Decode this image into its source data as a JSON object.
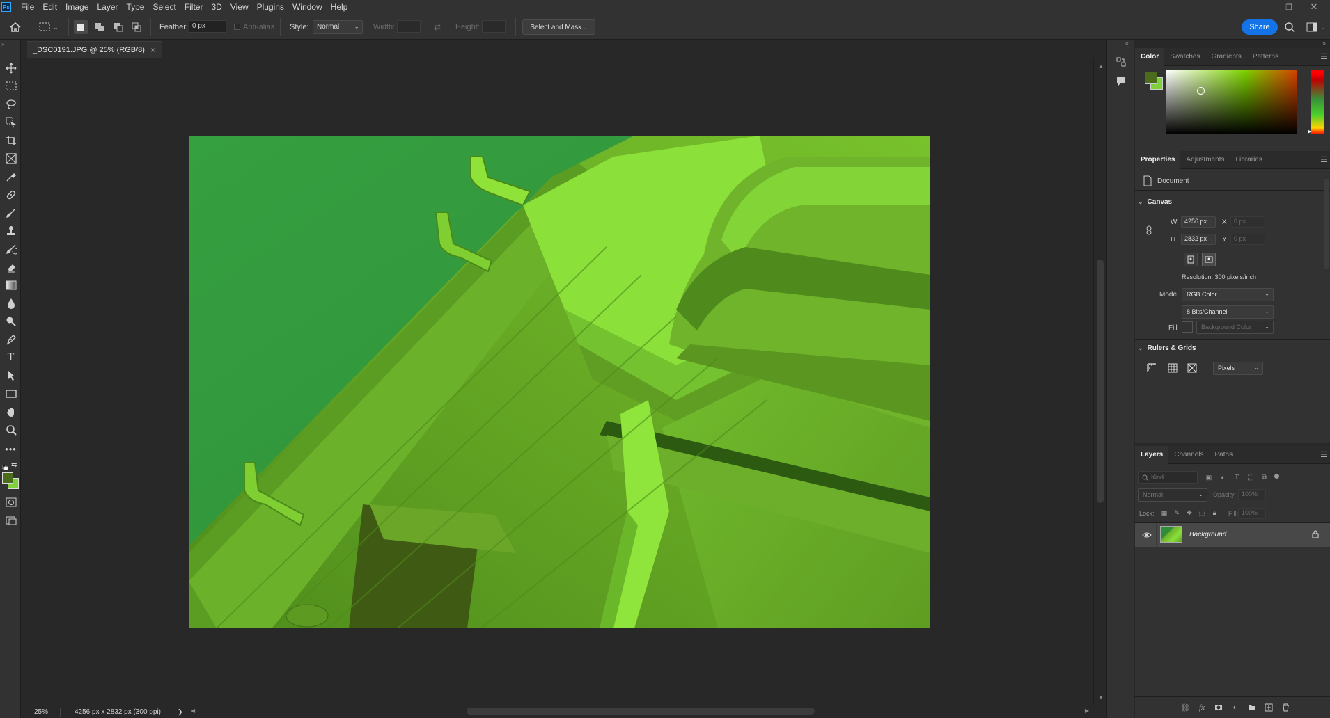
{
  "app": {
    "logo_text": "Ps"
  },
  "menu": [
    "File",
    "Edit",
    "Image",
    "Layer",
    "Type",
    "Select",
    "Filter",
    "3D",
    "View",
    "Plugins",
    "Window",
    "Help"
  ],
  "window_controls": {
    "minimize": "–",
    "restore": "❐",
    "close": "✕"
  },
  "options": {
    "feather_label": "Feather:",
    "feather_value": "0 px",
    "antialias_label": "Anti-alias",
    "style_label": "Style:",
    "style_value": "Normal",
    "width_label": "Width:",
    "height_label": "Height:",
    "select_mask_label": "Select and Mask...",
    "share_label": "Share"
  },
  "document": {
    "tab_title": "_DSC0191.JPG @ 25% (RGB/8)",
    "tab_close": "×"
  },
  "status": {
    "zoom": "25%",
    "doc_info": "4256 px x 2832 px (300 ppi)",
    "arrow": "❯"
  },
  "color_panel": {
    "tabs": [
      "Color",
      "Swatches",
      "Gradients",
      "Patterns"
    ],
    "foreground": "#4b6b1d",
    "background": "#7fd13b"
  },
  "properties_panel": {
    "tabs": [
      "Properties",
      "Adjustments",
      "Libraries"
    ],
    "doc_label": "Document",
    "canvas_section": "Canvas",
    "w_label": "W",
    "w_value": "4256 px",
    "h_label": "H",
    "h_value": "2832 px",
    "x_label": "X",
    "x_value": "0 px",
    "y_label": "Y",
    "y_value": "0 px",
    "resolution": "Resolution: 300 pixels/inch",
    "mode_label": "Mode",
    "mode_value": "RGB Color",
    "bits_value": "8 Bits/Channel",
    "fill_label": "Fill",
    "fill_value": "Background Color",
    "rulers_section": "Rulers & Grids",
    "units_value": "Pixels"
  },
  "layers_panel": {
    "tabs": [
      "Layers",
      "Channels",
      "Paths"
    ],
    "kind_placeholder": "Kind",
    "blend_mode": "Normal",
    "opacity_label": "Opacity:",
    "opacity_value": "100%",
    "lock_label": "Lock:",
    "fill_label": "Fill:",
    "fill_value": "100%",
    "layer_name": "Background"
  }
}
